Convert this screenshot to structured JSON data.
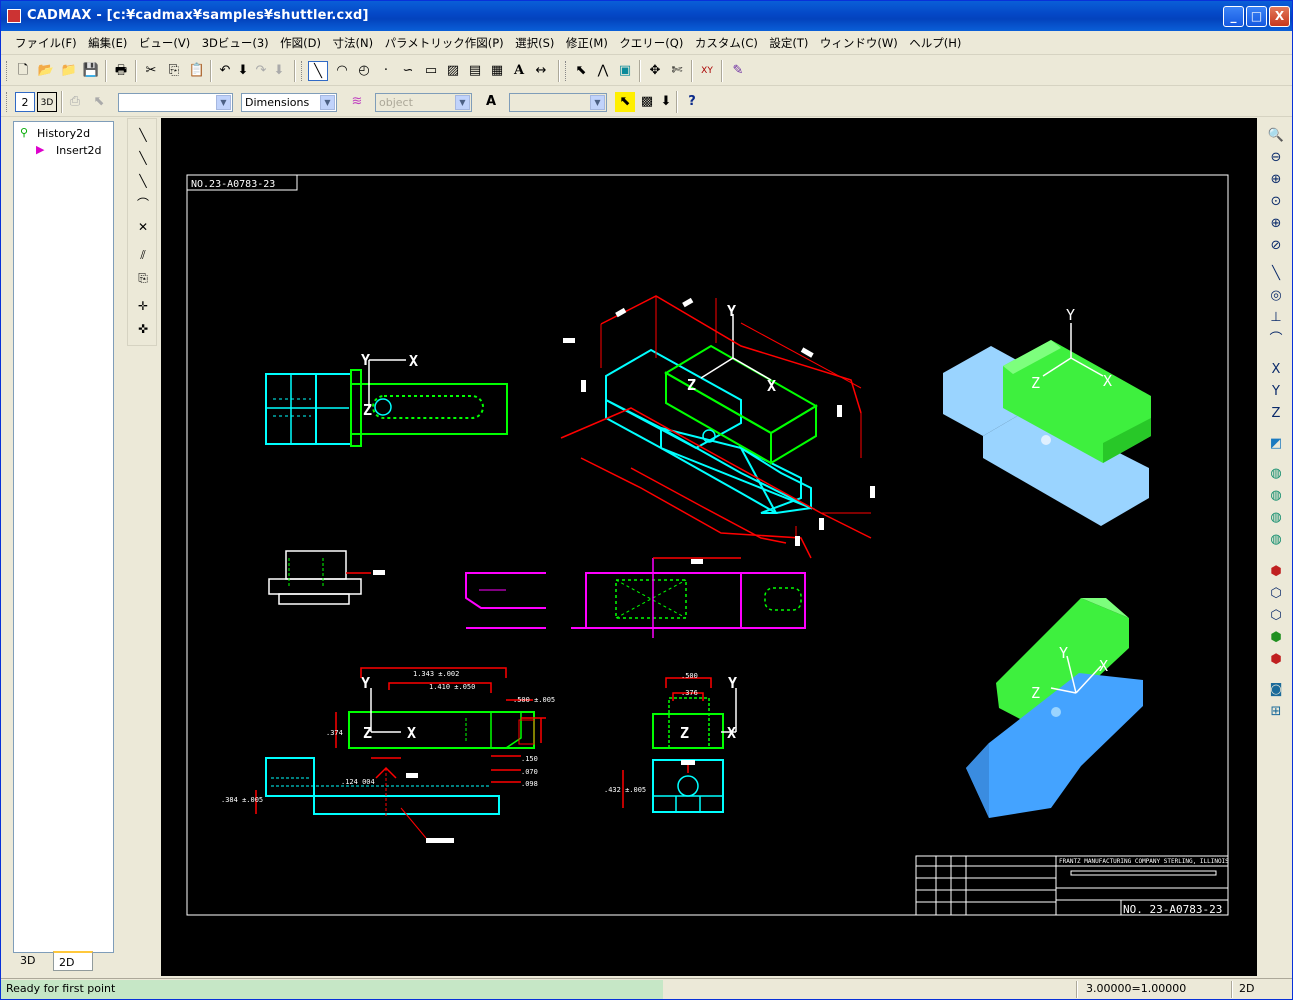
{
  "window": {
    "title": "CADMAX - [c:¥cadmax¥samples¥shuttler.cxd]",
    "minimize": "_",
    "maximize": "□",
    "close": "X"
  },
  "menu": [
    {
      "label": "ファイル(F)"
    },
    {
      "label": "編集(E)"
    },
    {
      "label": "ビュー(V)"
    },
    {
      "label": "3Dビュー(3)"
    },
    {
      "label": "作図(D)"
    },
    {
      "label": "寸法(N)"
    },
    {
      "label": "パラメトリック作図(P)"
    },
    {
      "label": "選択(S)"
    },
    {
      "label": "修正(M)"
    },
    {
      "label": "クエリー(Q)"
    },
    {
      "label": "カスタム(C)"
    },
    {
      "label": "設定(T)"
    },
    {
      "label": "ウィンドウ(W)"
    },
    {
      "label": "ヘルプ(H)"
    }
  ],
  "toolbar2": {
    "mode2d": "2",
    "mode3d": "3D",
    "combo1": "",
    "dimensions": "Dimensions",
    "object": "object",
    "text_icon": "A",
    "combo4": "",
    "help": "?"
  },
  "tree": {
    "root": "History2d",
    "child": "Insert2d"
  },
  "tabs": {
    "tab3d": "3D",
    "tab2d": "2D"
  },
  "drawing": {
    "number_top": "NO.23-A0783-23",
    "number_block": "NO. 23-A0783-23",
    "company": "FRANTZ MANUFACTURING COMPANY  STERLING, ILLINOIS",
    "axis_x": "X",
    "axis_y": "Y",
    "axis_z": "Z",
    "dim1": "1.343 ±.002",
    "dim2": "1.410 ±.050",
    "dim3": ".500 ±.005",
    "dim4": ".374",
    "dim5": ".500",
    "dim6": ".376",
    "dim7": ".432 ±.005",
    "dim8": ".384 ±.005",
    "dim9": ".124 004",
    "dim10": ".150",
    "dim11": ".070",
    "dim12": ".098"
  },
  "status": {
    "message": "Ready for first point",
    "scale": "3.00000=1.00000",
    "mode": "2D"
  }
}
